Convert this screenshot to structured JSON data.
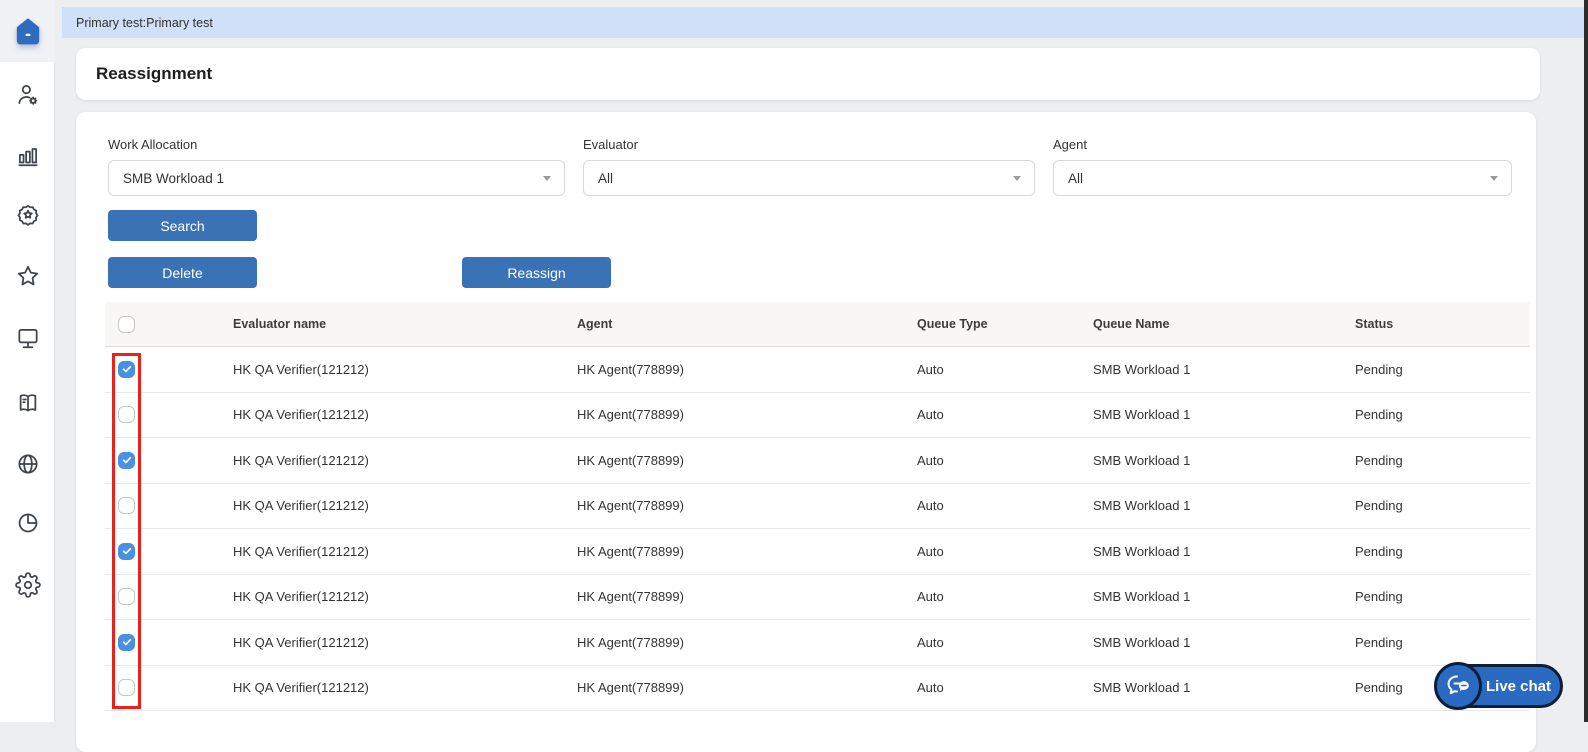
{
  "topbar": {
    "title": "Primary test:Primary test"
  },
  "sidebar": {
    "items": [
      {
        "icon": "home-icon",
        "active": true
      },
      {
        "icon": "user-gear-icon",
        "active": false
      },
      {
        "icon": "bar-chart-icon",
        "active": false
      },
      {
        "icon": "badge-star-icon",
        "active": false
      },
      {
        "icon": "star-icon",
        "active": false
      },
      {
        "icon": "monitor-icon",
        "active": false
      },
      {
        "icon": "book-icon",
        "active": false
      },
      {
        "icon": "globe-icon",
        "active": false
      },
      {
        "icon": "pie-chart-icon",
        "active": false
      },
      {
        "icon": "gear-icon",
        "active": false
      }
    ]
  },
  "page": {
    "title": "Reassignment"
  },
  "filters": {
    "work_allocation": {
      "label": "Work Allocation",
      "value": "SMB Workload 1"
    },
    "evaluator": {
      "label": "Evaluator",
      "value": "All"
    },
    "agent": {
      "label": "Agent",
      "value": "All"
    }
  },
  "buttons": {
    "search": "Search",
    "delete": "Delete",
    "reassign": "Reassign"
  },
  "table": {
    "columns": [
      "Evaluator name",
      "Agent",
      "Queue Type",
      "Queue Name",
      "Status"
    ],
    "rows": [
      {
        "checked": true,
        "evaluator": "HK QA Verifier(121212)",
        "agent": "HK Agent(778899)",
        "queue_type": "Auto",
        "queue_name": "SMB Workload 1",
        "status": "Pending"
      },
      {
        "checked": false,
        "evaluator": "HK QA Verifier(121212)",
        "agent": "HK Agent(778899)",
        "queue_type": "Auto",
        "queue_name": "SMB Workload 1",
        "status": "Pending"
      },
      {
        "checked": true,
        "evaluator": "HK QA Verifier(121212)",
        "agent": "HK Agent(778899)",
        "queue_type": "Auto",
        "queue_name": "SMB Workload 1",
        "status": "Pending"
      },
      {
        "checked": false,
        "evaluator": "HK QA Verifier(121212)",
        "agent": "HK Agent(778899)",
        "queue_type": "Auto",
        "queue_name": "SMB Workload 1",
        "status": "Pending"
      },
      {
        "checked": true,
        "evaluator": "HK QA Verifier(121212)",
        "agent": "HK Agent(778899)",
        "queue_type": "Auto",
        "queue_name": "SMB Workload 1",
        "status": "Pending"
      },
      {
        "checked": false,
        "evaluator": "HK QA Verifier(121212)",
        "agent": "HK Agent(778899)",
        "queue_type": "Auto",
        "queue_name": "SMB Workload 1",
        "status": "Pending"
      },
      {
        "checked": true,
        "evaluator": "HK QA Verifier(121212)",
        "agent": "HK Agent(778899)",
        "queue_type": "Auto",
        "queue_name": "SMB Workload 1",
        "status": "Pending"
      },
      {
        "checked": false,
        "evaluator": "HK QA Verifier(121212)",
        "agent": "HK Agent(778899)",
        "queue_type": "Auto",
        "queue_name": "SMB Workload 1",
        "status": "Pending"
      }
    ]
  },
  "live_chat": {
    "label": "Live chat"
  },
  "colors": {
    "topbar_bg": "#cfe0f8",
    "button_blue": "#3973b5",
    "checkbox_checked": "#4a90e0",
    "annotation_red": "#e8231c",
    "livechat_blue": "#2a6ac0",
    "livechat_border": "#0c1f38",
    "table_header_bg": "#f8f7f5"
  }
}
